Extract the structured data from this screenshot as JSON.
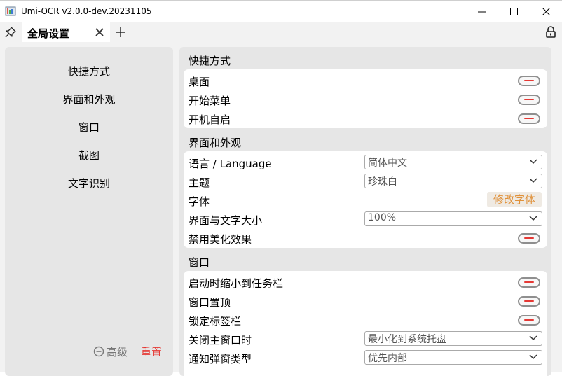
{
  "window": {
    "title": "Umi-OCR v2.0.0-dev.20231105"
  },
  "tabs": [
    {
      "label": "全局设置"
    }
  ],
  "sidebar": {
    "items": [
      {
        "label": "快捷方式"
      },
      {
        "label": "界面和外观"
      },
      {
        "label": "窗口"
      },
      {
        "label": "截图"
      },
      {
        "label": "文字识别"
      }
    ],
    "advanced_label": "高级",
    "reset_label": "重置"
  },
  "groups": {
    "shortcuts": {
      "title": "快捷方式",
      "rows": [
        {
          "label": "桌面"
        },
        {
          "label": "开始菜单"
        },
        {
          "label": "开机自启"
        }
      ]
    },
    "appearance": {
      "title": "界面和外观",
      "language": {
        "label": "语言 / Language",
        "value": "简体中文"
      },
      "theme": {
        "label": "主题",
        "value": "珍珠白"
      },
      "font": {
        "label": "字体",
        "button": "修改字体"
      },
      "scale": {
        "label": "界面与文字大小",
        "value": "100%"
      },
      "effects": {
        "label": "禁用美化效果"
      }
    },
    "window": {
      "title": "窗口",
      "minimize": {
        "label": "启动时缩小到任务栏"
      },
      "topmost": {
        "label": "窗口置顶"
      },
      "lock_tabs": {
        "label": "锁定标签栏"
      },
      "close_action": {
        "label": "关闭主窗口时",
        "value": "最小化到系统托盘"
      },
      "popup_type": {
        "label": "通知弹窗类型",
        "value": "优先内部"
      }
    }
  },
  "colors": {
    "accent_red": "#e53935",
    "accent_orange": "#e0913a",
    "panel_bg": "#e6e6e6"
  }
}
